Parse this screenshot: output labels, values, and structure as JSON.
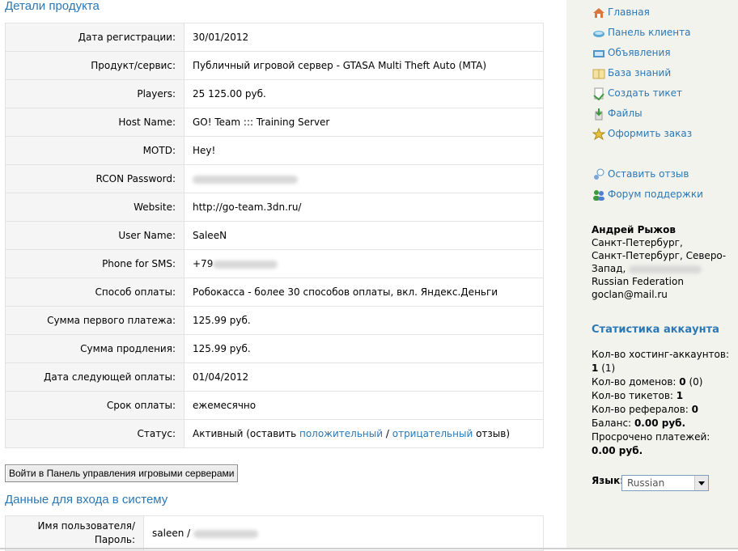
{
  "product_details": {
    "title": "Детали продукта",
    "rows": [
      {
        "label": "Дата регистрации:",
        "value": "30/01/2012"
      },
      {
        "label": "Продукт/сервис:",
        "value": "Публичный игровой сервер - GTASA Multi Theft Auto (MTA)"
      },
      {
        "label": "Players:",
        "value": "25 125.00 руб."
      },
      {
        "label": "Host Name:",
        "value": "GO! Team ::: Training Server"
      },
      {
        "label": "MOTD:",
        "value": "Hey!"
      },
      {
        "label": "RCON Password:",
        "value": ""
      },
      {
        "label": "Website:",
        "value": "http://go-team.3dn.ru/"
      },
      {
        "label": "User Name:",
        "value": "SaleeN"
      },
      {
        "label": "Phone for SMS:",
        "value": "+79"
      },
      {
        "label": "Способ оплаты:",
        "value": "Робокасса - более 30 способов оплаты, вкл. Яндекс.Деньги"
      },
      {
        "label": "Сумма первого платежа:",
        "value": "125.99 руб."
      },
      {
        "label": "Сумма продления:",
        "value": "125.99 руб."
      },
      {
        "label": "Дата следующей оплаты:",
        "value": "01/04/2012"
      },
      {
        "label": "Срок оплаты:",
        "value": "ежемесячно"
      }
    ],
    "status": {
      "label": "Статус:",
      "prefix": "Активный (оставить",
      "positive": "положительный",
      "sep": "/",
      "negative": "отрицательный",
      "suffix": "отзыв)"
    }
  },
  "panel_button": "Войти в Панель управления игровыми серверами",
  "login": {
    "title": "Данные для входа в систему",
    "label": "Имя пользователя/ Пароль:",
    "value": "saleen /"
  },
  "sidebar": {
    "nav": [
      {
        "label": "Главная",
        "icon": "home-icon"
      },
      {
        "label": "Панель клиента",
        "icon": "client-panel-icon"
      },
      {
        "label": "Объявления",
        "icon": "announcements-icon"
      },
      {
        "label": "База знаний",
        "icon": "knowledgebase-icon"
      },
      {
        "label": "Создать тикет",
        "icon": "ticket-icon"
      },
      {
        "label": "Файлы",
        "icon": "files-icon"
      },
      {
        "label": "Оформить заказ",
        "icon": "order-icon"
      }
    ],
    "nav2": [
      {
        "label": "Оставить отзыв",
        "icon": "feedback-icon"
      },
      {
        "label": "Форум поддержки",
        "icon": "forum-icon"
      }
    ],
    "address": {
      "name": "Андрей Рыжов",
      "line1": "Санкт-Петербург,",
      "line2": "Санкт-Петербург, Северо-",
      "line3": "Запад,",
      "country": "Russian Federation",
      "email": "goclan@mail.ru"
    },
    "stats": {
      "title": "Статистика аккаунта",
      "hosting_label": "Кол-во хостинг-аккаунтов:",
      "hosting_value": "1",
      "hosting_extra": "(1)",
      "domains_label": "Кол-во доменов:",
      "domains_value": "0",
      "domains_extra": "(0)",
      "tickets_label": "Кол-во тикетов:",
      "tickets_value": "1",
      "referrals_label": "Кол-во рефералов:",
      "referrals_value": "0",
      "balance_label": "Баланс:",
      "balance_value": "0.00 руб.",
      "overdue_label": "Просрочено платежей:",
      "overdue_value": "0.00 руб."
    },
    "language": {
      "label": "Язык:",
      "selected": "Russian"
    }
  },
  "colors": {
    "link": "#2a78b5",
    "sidebar_bg": "#f3f3ee",
    "label_bg": "#f5f5f5",
    "border": "#e3e3e3"
  }
}
